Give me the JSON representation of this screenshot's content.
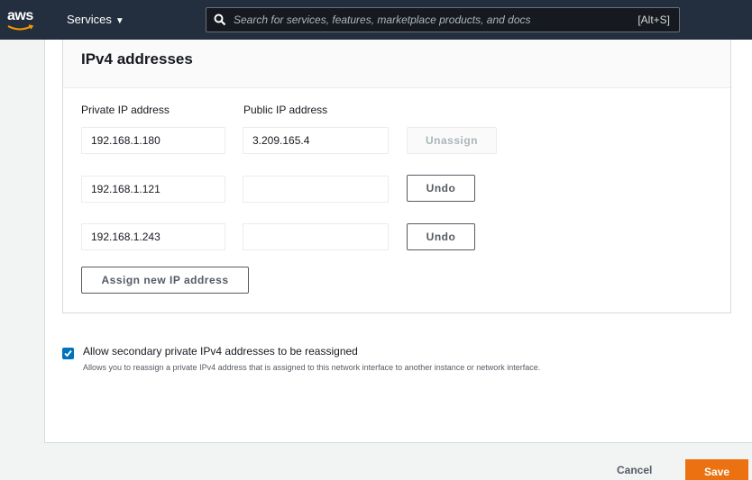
{
  "topnav": {
    "logo_text": "aws",
    "services_label": "Services",
    "search_placeholder": "Search for services, features, marketplace products, and docs",
    "search_shortcut": "[Alt+S]"
  },
  "ipv4": {
    "title": "IPv4 addresses",
    "private_label": "Private IP address",
    "public_label": "Public IP address",
    "rows": [
      {
        "private": "192.168.1.180",
        "public": "3.209.165.4",
        "action": "Unassign",
        "action_disabled": true
      },
      {
        "private": "192.168.1.121",
        "public": "",
        "action": "Undo",
        "action_disabled": false
      },
      {
        "private": "192.168.1.243",
        "public": "",
        "action": "Undo",
        "action_disabled": false
      }
    ],
    "assign_label": "Assign new IP address"
  },
  "reassign": {
    "checked": true,
    "label": "Allow secondary private IPv4 addresses to be reassigned",
    "description": "Allows you to reassign a private IPv4 address that is assigned to this network interface to another instance or network interface."
  },
  "footer": {
    "cancel_label": "Cancel",
    "save_label": "Save"
  },
  "colors": {
    "nav_bg": "#232f3e",
    "primary": "#ec7211",
    "checkbox": "#0073bb"
  }
}
